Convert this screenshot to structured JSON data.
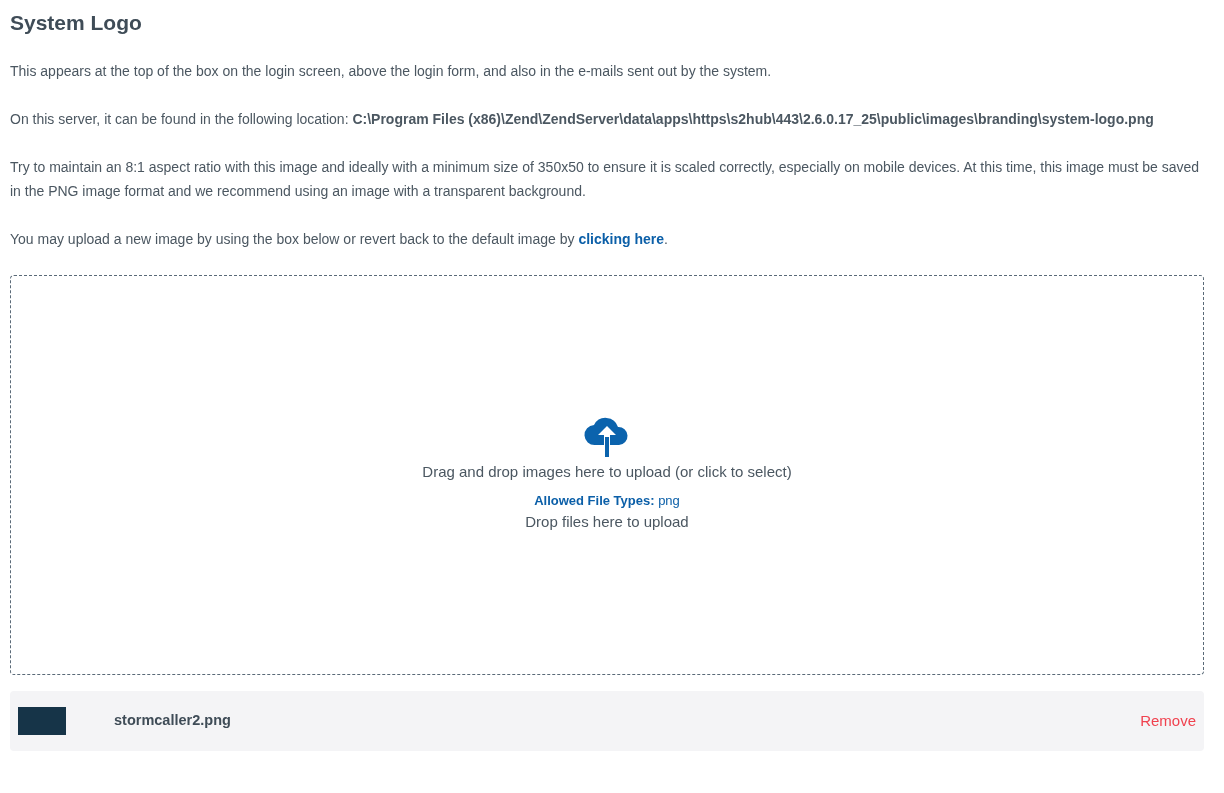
{
  "title": "System Logo",
  "paragraphs": [
    {
      "text": "This appears at the top of the box on the login screen, above the login form, and also in the e-mails sent out by the system."
    },
    {
      "text": "On this server, it can be found in the following location: **C:\\Program Files (x86)\\Zend\\ZendServer\\data\\apps\\https\\s2hub\\443\\2.6.0.17_25\\public\\images\\branding\\system-logo.png**"
    },
    {
      "text": "Try to maintain an 8:1 aspect ratio with this image and ideally with a minimum size of 350x50 to ensure it is scaled correctly, especially on mobile devices. At this time, this image must be saved in the PNG image format and we recommend using an image with a transparent background."
    },
    {
      "text": "You may upload a new image by using the box below or revert back to the default image by ",
      "link": "clicking here",
      "after": "."
    }
  ],
  "dropzone": {
    "message": "Drag and drop images here to upload (or click to select)",
    "allowed_label": "Allowed File Types:",
    "allowed_types": "png",
    "hint": "Drop files here to upload"
  },
  "files": [
    {
      "name": "stormcaller2.png",
      "action": "Remove"
    }
  ]
}
